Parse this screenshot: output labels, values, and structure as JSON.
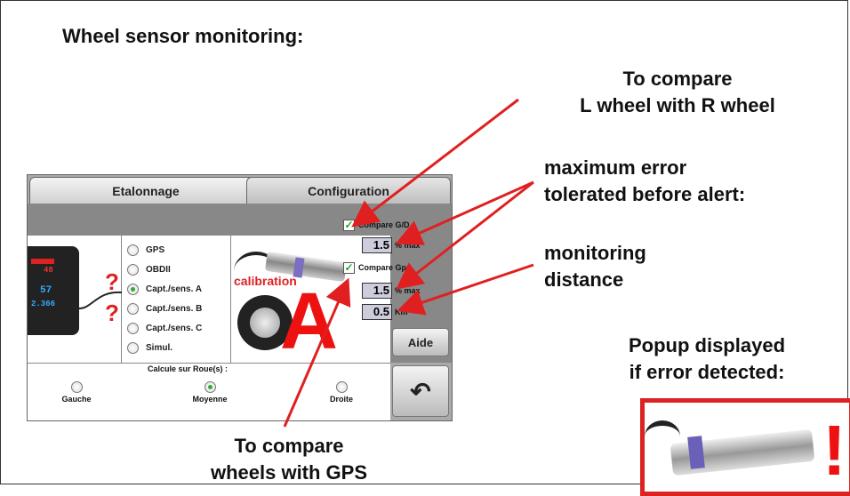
{
  "title": "Wheel sensor monitoring:",
  "annotations": {
    "compare_lr": [
      "To compare",
      "L wheel with R wheel"
    ],
    "max_error": [
      "maximum error",
      "tolerated before alert:"
    ],
    "monitoring": [
      "monitoring",
      "distance"
    ],
    "popup": [
      "Popup displayed",
      "if error detected:"
    ],
    "compare_gps": [
      "To compare",
      "wheels with GPS"
    ]
  },
  "screen": {
    "tabs": [
      "Etalonnage",
      "Configuration"
    ],
    "sources": [
      {
        "label": "GPS",
        "selected": false
      },
      {
        "label": "OBDII",
        "selected": false
      },
      {
        "label": "Capt./sens. A",
        "selected": true
      },
      {
        "label": "Capt./sens. B",
        "selected": false
      },
      {
        "label": "Capt./sens. C",
        "selected": false
      },
      {
        "label": "Simul.",
        "selected": false
      }
    ],
    "device_values": {
      "top": "48",
      "mid": "57",
      "bottom": "2.366"
    },
    "question_mark": "?",
    "calibration_label": "calibration",
    "calibration_letter": "A",
    "compare_gd": {
      "label": "Compare G/D",
      "checked": true,
      "value": "1.5",
      "unit": "% max"
    },
    "compare_gps": {
      "label": "Compare Gps",
      "checked": true,
      "value": "1.5",
      "unit": "% max"
    },
    "distance": {
      "value": "0.5",
      "unit": "Km"
    },
    "aide_label": "Aide",
    "back_icon": "back-arrow-icon",
    "roue": {
      "title": "Calcule sur Roue(s) :",
      "options": [
        {
          "label": "Gauche",
          "selected": false
        },
        {
          "label": "Moyenne",
          "selected": true
        },
        {
          "label": "Droite",
          "selected": false
        }
      ]
    }
  },
  "popup_icon": "exclamation-mark",
  "colors": {
    "arrow": "#e02020",
    "accent_red": "#dd2222",
    "check": "#22aa22"
  }
}
